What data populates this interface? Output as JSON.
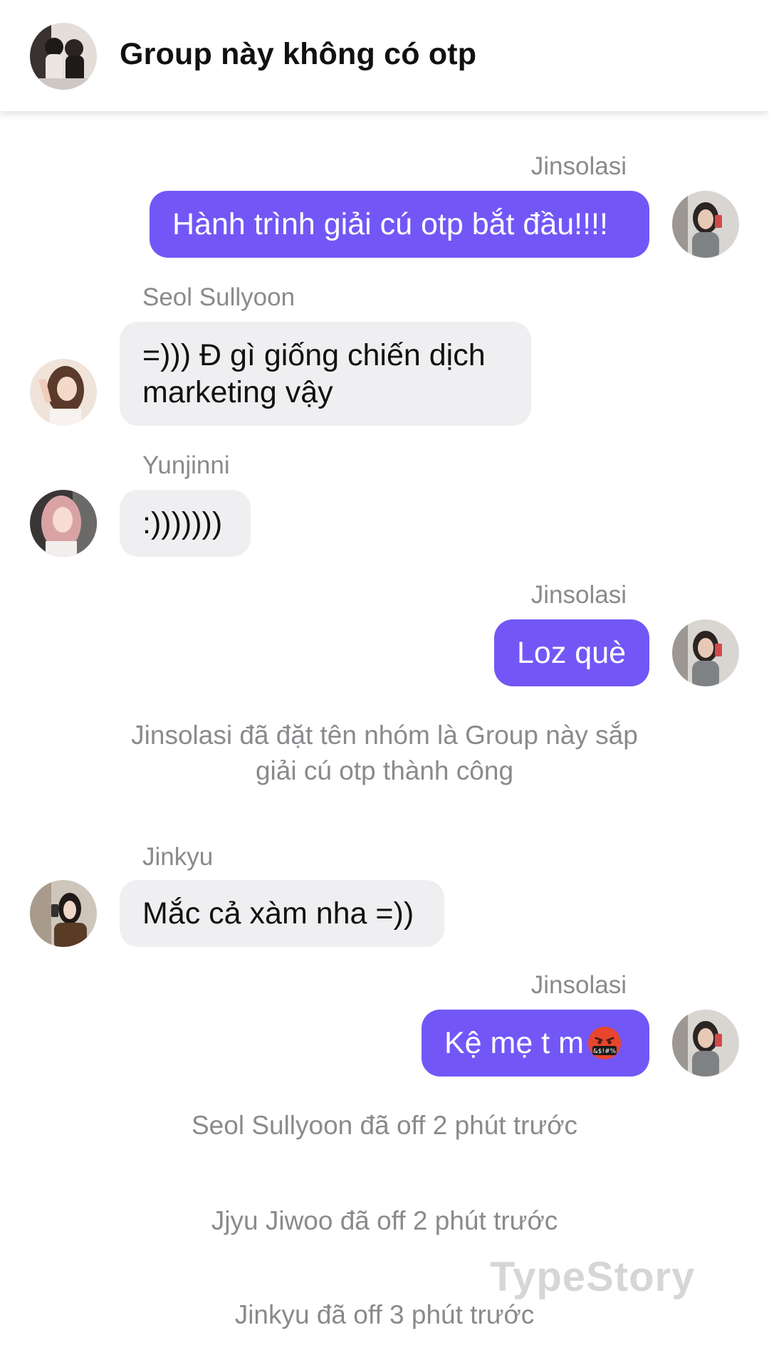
{
  "header": {
    "title": "Group này không có otp",
    "avatar_icon": "group-avatar-icon"
  },
  "messages": [
    {
      "sender": "Jinsolasi",
      "text": "Hành trình giải cú otp bắt đầu!!!!",
      "direction": "outgoing"
    },
    {
      "sender": "Seol Sullyoon",
      "text": "=))) Đ gì giống chiến dịch\nmarketing vậy",
      "direction": "incoming"
    },
    {
      "sender": "Yunjinni",
      "text": ":)))))))",
      "direction": "incoming"
    },
    {
      "sender": "Jinsolasi",
      "text": "Loz què",
      "direction": "outgoing"
    },
    {
      "sender": "Jinkyu",
      "text": "Mắc cả xàm nha =))",
      "direction": "incoming"
    },
    {
      "sender": "Jinsolasi",
      "text": "Kệ mẹ t m",
      "direction": "outgoing",
      "emoji_icon": "cursing-face-icon"
    }
  ],
  "system": {
    "rename_line1": "Jinsolasi đã đặt tên nhóm là Group này sắp",
    "rename_line2": "giải cú otp thành công",
    "off_1": "Seol Sullyoon đã off 2 phút trước",
    "off_2": "Jjyu Jiwoo đã off 2 phút trước",
    "off_3": "Jinkyu đã off 3 phút trước"
  },
  "watermark": "TypeStory",
  "colors": {
    "outgoing_bubble": "#7357f6",
    "incoming_bubble": "#efeff1",
    "meta_text": "#8a8a8e",
    "title_text": "#111111"
  }
}
